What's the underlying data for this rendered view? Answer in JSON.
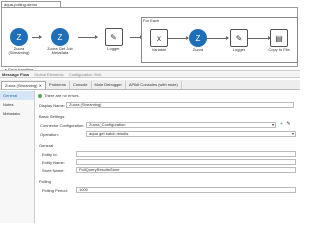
{
  "flow": {
    "tab": "aqua-polling-demo",
    "foreach": "For Each",
    "error_handling": "▸ Error handling",
    "nodes": [
      {
        "label": "Zuora (Streaming)"
      },
      {
        "label": "Zuora Get Job Metadata"
      },
      {
        "label": "Logger"
      },
      {
        "label": "Variable"
      },
      {
        "label": "Zuora"
      },
      {
        "label": "Logger"
      },
      {
        "label": "Copy to File"
      }
    ]
  },
  "tabs2": {
    "items": [
      "Message Flow",
      "Global Elements",
      "Configuration XML"
    ]
  },
  "tabs3": {
    "items": [
      "Zuora (Streaming) ✕",
      "Problems",
      "Console",
      "Mule Debugger",
      "APIkit Consoles (with mule)"
    ]
  },
  "side": {
    "items": [
      "General",
      "Notes",
      "Metadata"
    ]
  },
  "form": {
    "no_errors": "There are no errors.",
    "display_name_label": "Display Name:",
    "display_name": "Zuora (Streaming)",
    "basic": "Basic Settings",
    "conn_label": "Connector Configuration:",
    "conn": "Zuora_Configuration",
    "op_label": "Operation:",
    "op": "aqua get batch results",
    "general": "General",
    "entity_id": "Entity Id:",
    "entity_name": "Entity Name:",
    "store_name_label": "Store Name:",
    "store_name": "PollQueryResultsStore",
    "polling": "Polling",
    "period_label": "Polling Period:",
    "period": "1000"
  }
}
